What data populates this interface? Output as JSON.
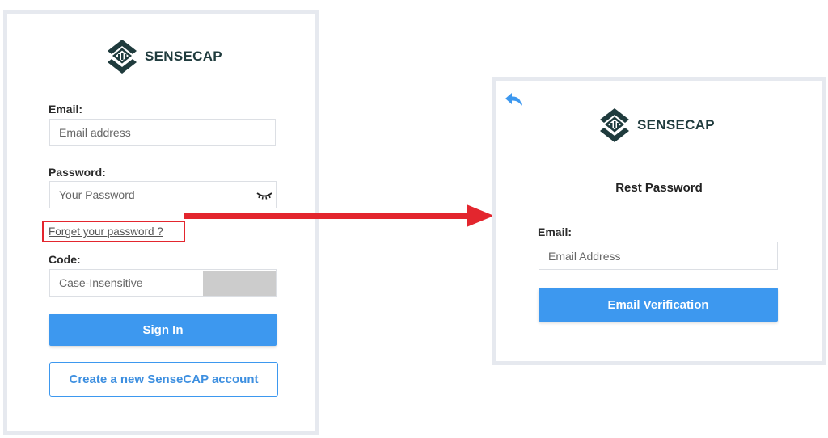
{
  "brand": {
    "name": "SENSECAP"
  },
  "login": {
    "email_label": "Email:",
    "email_placeholder": "Email address",
    "password_label": "Password:",
    "password_placeholder": "Your Password",
    "forgot_link": "Forget your password ?",
    "code_label": "Code:",
    "code_placeholder": "Case-Insensitive",
    "sign_in_label": "Sign In",
    "create_account_label": "Create a new SenseCAP account"
  },
  "reset": {
    "title": "Rest Password",
    "email_label": "Email:",
    "email_placeholder": "Email Address",
    "verify_label": "Email Verification"
  },
  "icons": {
    "logo": "sensecap-logo-icon",
    "eye": "eye-closed-icon",
    "back": "back-arrow-icon",
    "arrow": "right-arrow-annotation"
  },
  "colors": {
    "primary": "#3d98ef",
    "brand_dark": "#1f3b3d",
    "annotation_red": "#e3262e",
    "panel_border": "#e6e9ef"
  }
}
